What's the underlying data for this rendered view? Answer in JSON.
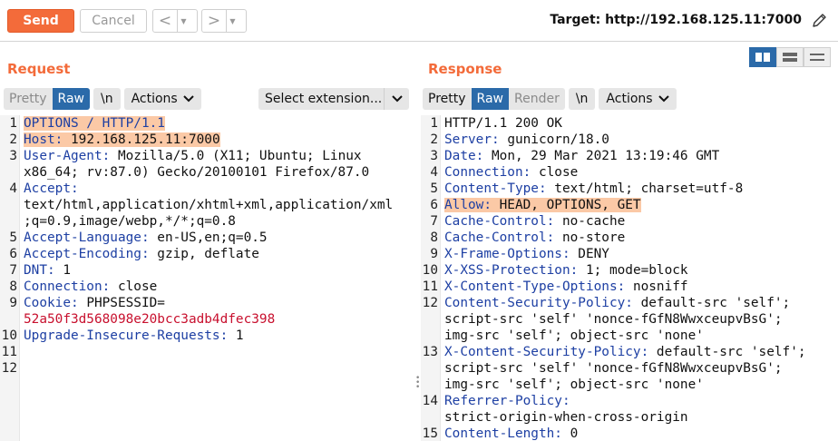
{
  "toolbar": {
    "send_label": "Send",
    "cancel_label": "Cancel",
    "back_glyph": "<",
    "forward_glyph": ">",
    "dropdown_glyph": "▼",
    "target_text": "Target: http://192.168.125.11:7000",
    "edit_icon": "pencil-icon"
  },
  "request": {
    "title": "Request",
    "tabs": [
      "Pretty",
      "Raw",
      "\\n"
    ],
    "active_tab": "Raw",
    "actions_label": "Actions",
    "select_extension_label": "Select extension...",
    "lines": [
      {
        "n": "1",
        "rows": [
          {
            "k": "OPTIONS / HTTP/1.1",
            "v": ""
          }
        ],
        "highlight": true
      },
      {
        "n": "2",
        "rows": [
          {
            "k": "Host:",
            "v": " 192.168.125.11:7000"
          }
        ],
        "highlight": true
      },
      {
        "n": "3",
        "rows": [
          {
            "k": "User-Agent:",
            "v": " Mozilla/5.0 (X11; Ubuntu; Linux"
          },
          {
            "k": "",
            "v": "x86_64; rv:87.0) Gecko/20100101 Firefox/87.0"
          }
        ]
      },
      {
        "n": "4",
        "rows": [
          {
            "k": "Accept:",
            "v": ""
          },
          {
            "k": "",
            "v": "text/html,application/xhtml+xml,application/xml"
          },
          {
            "k": "",
            "v": ";q=0.9,image/webp,*/*;q=0.8"
          }
        ]
      },
      {
        "n": "5",
        "rows": [
          {
            "k": "Accept-Language:",
            "v": " en-US,en;q=0.5"
          }
        ]
      },
      {
        "n": "6",
        "rows": [
          {
            "k": "Accept-Encoding:",
            "v": " gzip, deflate"
          }
        ]
      },
      {
        "n": "7",
        "rows": [
          {
            "k": "DNT:",
            "v": " 1"
          }
        ]
      },
      {
        "n": "8",
        "rows": [
          {
            "k": "Connection:",
            "v": " close"
          }
        ]
      },
      {
        "n": "9",
        "rows": [
          {
            "k": "Cookie:",
            "v": " PHPSESSID="
          },
          {
            "k": "",
            "v": "52a50f3d568098e20bcc3adb4dfec398",
            "cookie": true
          }
        ]
      },
      {
        "n": "10",
        "rows": [
          {
            "k": "Upgrade-Insecure-Requests:",
            "v": " 1"
          }
        ]
      },
      {
        "n": "11",
        "rows": [
          {
            "k": "",
            "v": ""
          }
        ]
      },
      {
        "n": "12",
        "rows": [
          {
            "k": "",
            "v": ""
          }
        ]
      }
    ]
  },
  "response": {
    "title": "Response",
    "tabs": [
      "Pretty",
      "Raw",
      "Render",
      "\\n"
    ],
    "active_tab": "Raw",
    "actions_label": "Actions",
    "lines": [
      {
        "n": "1",
        "rows": [
          {
            "k": "",
            "v": "HTTP/1.1 200 OK"
          }
        ]
      },
      {
        "n": "2",
        "rows": [
          {
            "k": "Server:",
            "v": " gunicorn/18.0"
          }
        ]
      },
      {
        "n": "3",
        "rows": [
          {
            "k": "Date:",
            "v": " Mon, 29 Mar 2021 13:19:46 GMT"
          }
        ]
      },
      {
        "n": "4",
        "rows": [
          {
            "k": "Connection:",
            "v": " close"
          }
        ]
      },
      {
        "n": "5",
        "rows": [
          {
            "k": "Content-Type:",
            "v": " text/html; charset=utf-8"
          }
        ]
      },
      {
        "n": "6",
        "rows": [
          {
            "k": "Allow:",
            "v": " HEAD, OPTIONS, GET"
          }
        ],
        "highlight": true
      },
      {
        "n": "7",
        "rows": [
          {
            "k": "Cache-Control:",
            "v": " no-cache"
          }
        ]
      },
      {
        "n": "8",
        "rows": [
          {
            "k": "Cache-Control:",
            "v": " no-store"
          }
        ]
      },
      {
        "n": "9",
        "rows": [
          {
            "k": "X-Frame-Options:",
            "v": " DENY"
          }
        ]
      },
      {
        "n": "10",
        "rows": [
          {
            "k": "X-XSS-Protection:",
            "v": " 1; mode=block"
          }
        ]
      },
      {
        "n": "11",
        "rows": [
          {
            "k": "X-Content-Type-Options:",
            "v": " nosniff"
          }
        ]
      },
      {
        "n": "12",
        "rows": [
          {
            "k": "Content-Security-Policy:",
            "v": " default-src 'self';"
          },
          {
            "k": "",
            "v": "script-src 'self' 'nonce-fGfN8WwxceupvBsG';"
          },
          {
            "k": "",
            "v": "img-src 'self'; object-src 'none'"
          }
        ]
      },
      {
        "n": "13",
        "rows": [
          {
            "k": "X-Content-Security-Policy:",
            "v": " default-src 'self';"
          },
          {
            "k": "",
            "v": "script-src 'self' 'nonce-fGfN8WwxceupvBsG';"
          },
          {
            "k": "",
            "v": "img-src 'self'; object-src 'none'"
          }
        ]
      },
      {
        "n": "14",
        "rows": [
          {
            "k": "Referrer-Policy:",
            "v": ""
          },
          {
            "k": "",
            "v": "strict-origin-when-cross-origin"
          }
        ]
      },
      {
        "n": "15",
        "rows": [
          {
            "k": "Content-Length:",
            "v": " 0"
          }
        ]
      }
    ]
  },
  "colors": {
    "accent": "#f36b3a",
    "active_tab": "#2b6aa9",
    "highlight": "#fbc9a6",
    "header_key": "#1d3fa3",
    "cookie_value": "#c8102e"
  }
}
